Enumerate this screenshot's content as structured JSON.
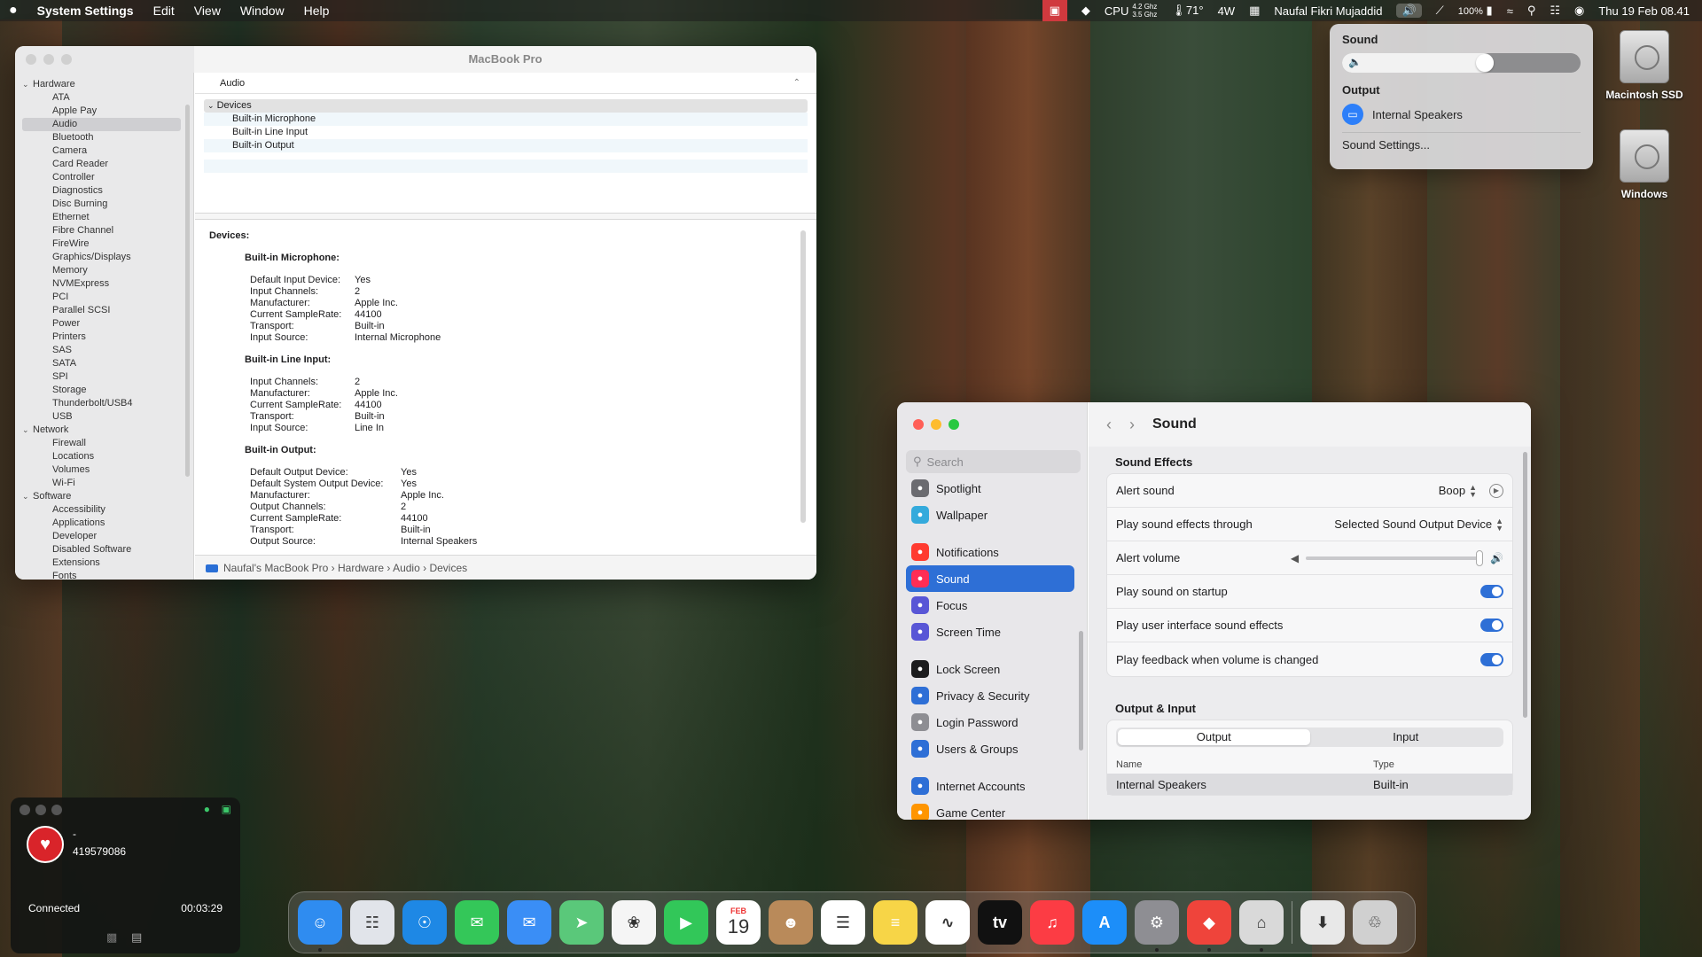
{
  "menubar": {
    "apple_icon": "apple-icon",
    "app": "System Settings",
    "menus": [
      "Edit",
      "View",
      "Window",
      "Help"
    ],
    "cpu_label": "CPU",
    "cpu_freq_top": "4.2 Ghz",
    "cpu_freq_bottom": "3.5 Ghz",
    "temp": "71°",
    "power": "4W",
    "user": "Naufal Fikri Mujaddid",
    "battery": "100%",
    "datetime": "Thu 19 Feb  08.41"
  },
  "sysinfo": {
    "title": "MacBook Pro",
    "sidebar": {
      "hardware": {
        "label": "Hardware",
        "items": [
          "ATA",
          "Apple Pay",
          "Audio",
          "Bluetooth",
          "Camera",
          "Card Reader",
          "Controller",
          "Diagnostics",
          "Disc Burning",
          "Ethernet",
          "Fibre Channel",
          "FireWire",
          "Graphics/Displays",
          "Memory",
          "NVMExpress",
          "PCI",
          "Parallel SCSI",
          "Power",
          "Printers",
          "SAS",
          "SATA",
          "SPI",
          "Storage",
          "Thunderbolt/USB4",
          "USB"
        ]
      },
      "network": {
        "label": "Network",
        "items": [
          "Firewall",
          "Locations",
          "Volumes",
          "Wi-Fi"
        ]
      },
      "software": {
        "label": "Software",
        "items": [
          "Accessibility",
          "Applications",
          "Developer",
          "Disabled Software",
          "Extensions",
          "Fonts"
        ]
      }
    },
    "section_header": "Audio",
    "tree": {
      "group": "Devices",
      "rows": [
        "Built-in Microphone",
        "Built-in Line Input",
        "Built-in Output"
      ]
    },
    "details": {
      "heading": "Devices:",
      "mic": {
        "title": "Built-in Microphone:",
        "rows": [
          [
            "Default Input Device:",
            "Yes"
          ],
          [
            "Input Channels:",
            "2"
          ],
          [
            "Manufacturer:",
            "Apple Inc."
          ],
          [
            "Current SampleRate:",
            "44100"
          ],
          [
            "Transport:",
            "Built-in"
          ],
          [
            "Input Source:",
            "Internal Microphone"
          ]
        ]
      },
      "line": {
        "title": "Built-in Line Input:",
        "rows": [
          [
            "Input Channels:",
            "2"
          ],
          [
            "Manufacturer:",
            "Apple Inc."
          ],
          [
            "Current SampleRate:",
            "44100"
          ],
          [
            "Transport:",
            "Built-in"
          ],
          [
            "Input Source:",
            "Line In"
          ]
        ]
      },
      "out": {
        "title": "Built-in Output:",
        "rows": [
          [
            "Default Output Device:",
            "Yes"
          ],
          [
            "Default System Output Device:",
            "Yes"
          ],
          [
            "Manufacturer:",
            "Apple Inc."
          ],
          [
            "Output Channels:",
            "2"
          ],
          [
            "Current SampleRate:",
            "44100"
          ],
          [
            "Transport:",
            "Built-in"
          ],
          [
            "Output Source:",
            "Internal Speakers"
          ]
        ]
      }
    },
    "pathbar": [
      "Naufal's MacBook Pro",
      "Hardware",
      "Audio",
      "Devices"
    ]
  },
  "soundmenu": {
    "title": "Sound",
    "volume": 0.6,
    "output_label": "Output",
    "device": "Internal Speakers",
    "settings_link": "Sound Settings..."
  },
  "desktop": {
    "disks": [
      "Macintosh SSD",
      "Windows"
    ]
  },
  "settings": {
    "search_placeholder": "Search",
    "nav": [
      {
        "label": "Spotlight",
        "icon": "spotlight-icon",
        "color": "#6b6b70"
      },
      {
        "label": "Wallpaper",
        "icon": "wallpaper-icon",
        "color": "#34aadc"
      },
      {
        "label": "Notifications",
        "icon": "bell-icon",
        "color": "#ff3b30",
        "gap": true
      },
      {
        "label": "Sound",
        "icon": "speaker-icon",
        "color": "#ff2d55",
        "selected": true
      },
      {
        "label": "Focus",
        "icon": "moon-icon",
        "color": "#5856d6"
      },
      {
        "label": "Screen Time",
        "icon": "hourglass-icon",
        "color": "#5856d6"
      },
      {
        "label": "Lock Screen",
        "icon": "lock-icon",
        "color": "#1c1c1e",
        "gap": true
      },
      {
        "label": "Privacy & Security",
        "icon": "hand-icon",
        "color": "#2e6fd6"
      },
      {
        "label": "Login Password",
        "icon": "key-lock-icon",
        "color": "#8e8e93"
      },
      {
        "label": "Users & Groups",
        "icon": "users-icon",
        "color": "#2e6fd6"
      },
      {
        "label": "Internet Accounts",
        "icon": "at-icon",
        "color": "#2e6fd6",
        "gap": true
      },
      {
        "label": "Game Center",
        "icon": "game-center-icon",
        "color": "#ff9500"
      }
    ],
    "title": "Sound",
    "effects_title": "Sound Effects",
    "alert_sound_label": "Alert sound",
    "alert_sound_value": "Boop",
    "play_through_label": "Play sound effects through",
    "play_through_value": "Selected Sound Output Device",
    "alert_volume_label": "Alert volume",
    "alert_volume": 1.0,
    "startup_label": "Play sound on startup",
    "startup_on": true,
    "ui_effects_label": "Play user interface sound effects",
    "ui_effects_on": true,
    "feedback_label": "Play feedback when volume is changed",
    "feedback_on": true,
    "output_input_title": "Output & Input",
    "tabs": [
      "Output",
      "Input"
    ],
    "selected_tab": "Output",
    "table_headers": [
      "Name",
      "Type"
    ],
    "table_rows": [
      [
        "Internal Speakers",
        "Built-in"
      ]
    ]
  },
  "call": {
    "name": "-",
    "number": "419579086",
    "status": "Connected",
    "duration": "00:03:29"
  },
  "dock": {
    "apps": [
      {
        "name": "finder-icon",
        "color": "#2f8cf0",
        "running": true
      },
      {
        "name": "launchpad-icon",
        "color": "#e1e4ea"
      },
      {
        "name": "safari-icon",
        "color": "#1e88e5"
      },
      {
        "name": "messages-icon",
        "color": "#34c759"
      },
      {
        "name": "mail-icon",
        "color": "#3a8ef6"
      },
      {
        "name": "maps-icon",
        "color": "#5ac87a"
      },
      {
        "name": "photos-icon",
        "color": "#f5f5f5"
      },
      {
        "name": "facetime-icon",
        "color": "#32c759"
      },
      {
        "name": "calendar-icon",
        "color": "#ffffff"
      },
      {
        "name": "contacts-icon",
        "color": "#b98a5a"
      },
      {
        "name": "reminders-icon",
        "color": "#ffffff"
      },
      {
        "name": "notes-icon",
        "color": "#f7d547"
      },
      {
        "name": "freeform-icon",
        "color": "#ffffff"
      },
      {
        "name": "appletv-icon",
        "color": "#111111"
      },
      {
        "name": "music-icon",
        "color": "#fc3c44"
      },
      {
        "name": "appstore-icon",
        "color": "#1c8ef9"
      },
      {
        "name": "system-settings-icon",
        "color": "#8e8e93",
        "running": true
      },
      {
        "name": "anydesk-icon",
        "color": "#ef443b",
        "running": true
      },
      {
        "name": "system-information-icon",
        "color": "#d9d9d9",
        "running": true
      }
    ],
    "calendar_month": "FEB",
    "calendar_day": "19",
    "appletv_label": "tv",
    "extras": [
      {
        "name": "downloads-stack-icon",
        "color": "#e8e8e8"
      },
      {
        "name": "trash-icon",
        "color": "#d0d0d0"
      }
    ]
  }
}
